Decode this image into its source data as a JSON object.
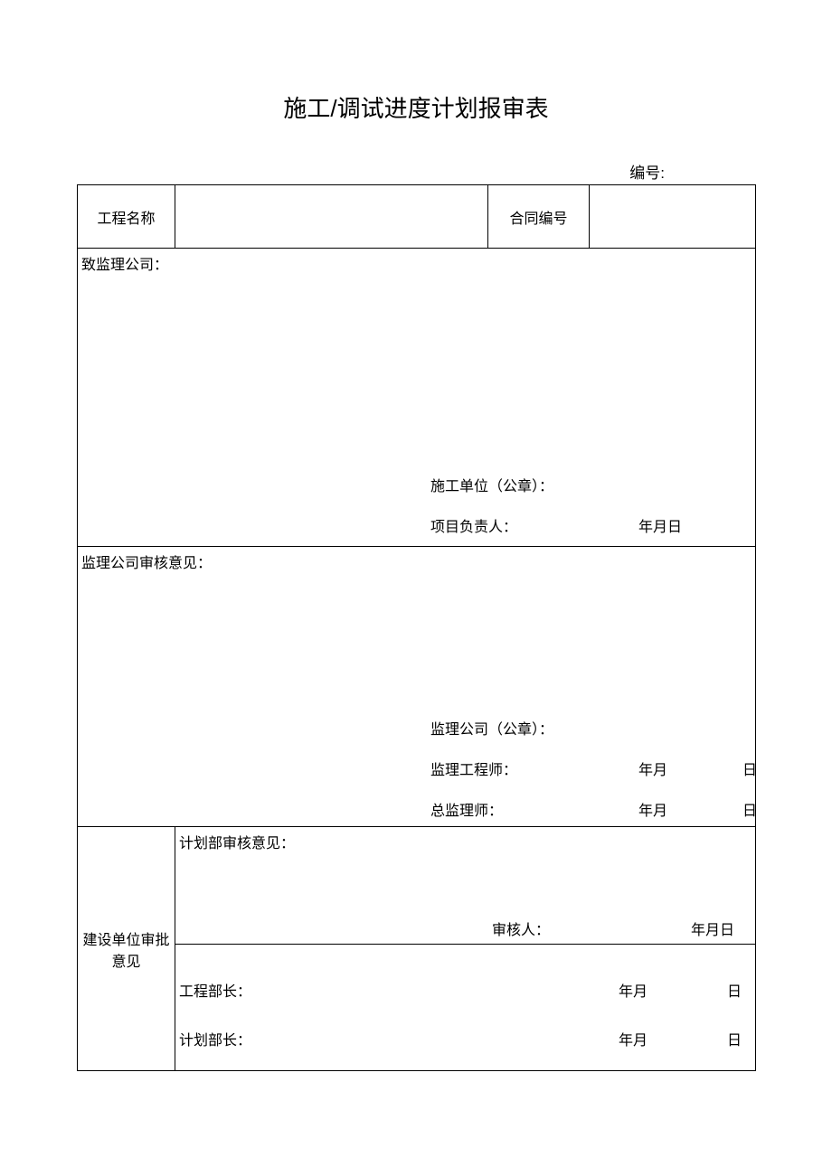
{
  "title": "施工/调试进度计划报审表",
  "docNumberLabel": "编号:",
  "row1": {
    "projectNameLabel": "工程名称",
    "contractNoLabel": "合同编号"
  },
  "section1": {
    "header": "致监理公司：",
    "stampLabel": "施工单位（公章）：",
    "leaderLabel": "项目负责人：",
    "dateLabel": "年月日"
  },
  "section2": {
    "header": "监理公司审核意见：",
    "stampLabel": "监理公司（公章）：",
    "engineerLabel": "监理工程师：",
    "chiefLabel": "总监理师：",
    "ym": "年月",
    "d": "日"
  },
  "section3": {
    "approvalLabel": "建设单位审批意见",
    "planHeader": "计划部审核意见：",
    "reviewerLabel": "审核人：",
    "reviewerDate": "年月日",
    "engDeptHead": "工程部长：",
    "planDeptHead": "计划部长：",
    "ym": "年月",
    "d": "日"
  }
}
